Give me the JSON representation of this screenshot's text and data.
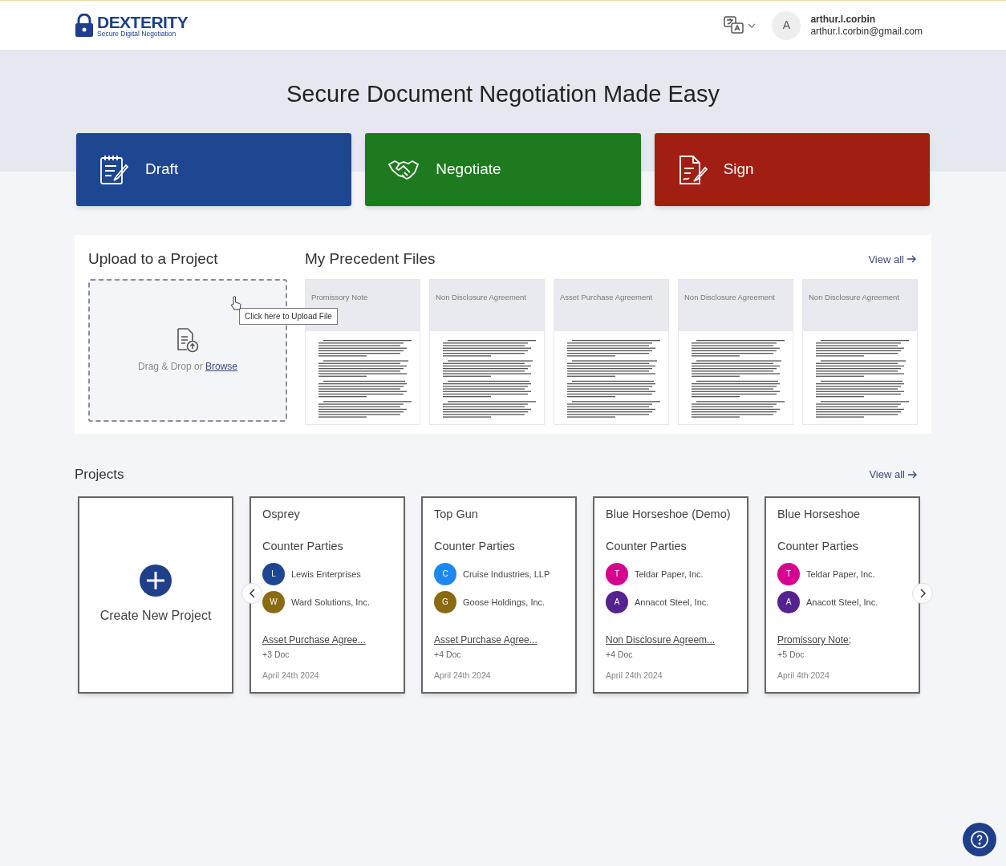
{
  "header": {
    "logo_title": "DEXTERITY",
    "logo_subtitle": "Secure Digital Negotiation",
    "user_initial": "A",
    "user_name": "arthur.l.corbin",
    "user_email": "arthur.l.corbin@gmail.com"
  },
  "hero_title": "Secure Document Negotiation Made Easy",
  "actions": [
    {
      "kind": "draft",
      "label": "Draft",
      "color": "#1f4690"
    },
    {
      "kind": "negotiate",
      "label": "Negotiate",
      "color": "#1e7a1e"
    },
    {
      "kind": "sign",
      "label": "Sign",
      "color": "#a01e12"
    }
  ],
  "upload": {
    "title": "Upload to a Project",
    "text": "Drag & Drop or",
    "link": "Browse",
    "tooltip": "Click here to Upload File"
  },
  "precedents": {
    "title": "My Precedent Files",
    "view_all": "View all",
    "files": [
      {
        "title": "Promissory Note"
      },
      {
        "title": "Non Disclosure Agreement"
      },
      {
        "title": "Asset Purchase Agreement"
      },
      {
        "title": "Non Disclosure Agreement"
      },
      {
        "title": "Non Disclosure Agreement"
      }
    ]
  },
  "projects": {
    "title": "Projects",
    "view_all": "View all",
    "create_label": "Create New Project",
    "cards": [
      {
        "name": "Osprey",
        "parties_label": "Counter Parties",
        "parties": [
          {
            "initial": "L",
            "name": "Lewis Enterprises",
            "color": "#1f4690"
          },
          {
            "initial": "W",
            "name": "Ward Solutions, Inc.",
            "color": "#8a6a12"
          }
        ],
        "document": "Asset Purchase Agree...",
        "doc_count": "+3 Doc",
        "date": "April 24th 2024"
      },
      {
        "name": "Top Gun",
        "parties_label": "Counter Parties",
        "parties": [
          {
            "initial": "C",
            "name": "Cruise Industries, LLP",
            "color": "#1e88f0"
          },
          {
            "initial": "G",
            "name": "Goose Holdings, Inc.",
            "color": "#8a6a12"
          }
        ],
        "document": "Asset Purchase Agree...",
        "doc_count": "+4 Doc",
        "date": "April 24th 2024"
      },
      {
        "name": "Blue Horseshoe (Demo)",
        "parties_label": "Counter Parties",
        "parties": [
          {
            "initial": "T",
            "name": "Teldar Paper, Inc.",
            "color": "#d8008f"
          },
          {
            "initial": "A",
            "name": "Annacot Steel, Inc.",
            "color": "#55238f"
          }
        ],
        "document": "Non Disclosure Agreem...",
        "doc_count": "+4 Doc",
        "date": "April 24th 2024"
      },
      {
        "name": "Blue Horseshoe",
        "parties_label": "Counter Parties",
        "parties": [
          {
            "initial": "T",
            "name": "Teldar Paper, Inc.",
            "color": "#d8008f"
          },
          {
            "initial": "A",
            "name": "Anacott Steel, Inc.",
            "color": "#55238f"
          }
        ],
        "document": "Promissory Note;",
        "doc_count": "+5 Doc",
        "date": "April 4th 2024"
      }
    ]
  }
}
